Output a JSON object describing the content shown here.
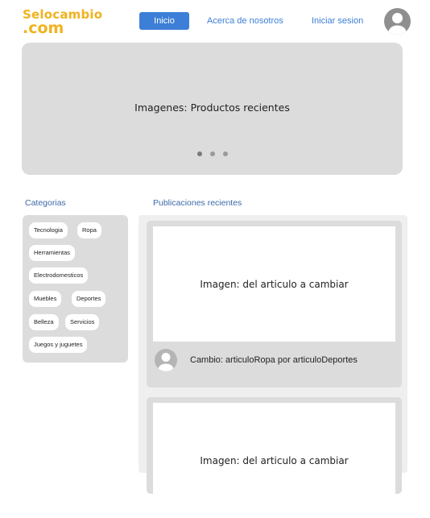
{
  "header": {
    "logo_line1": "Selocambio",
    "logo_line2": ".com",
    "nav": {
      "inicio": "Inicio",
      "acerca": "Acerca de nosotros",
      "login": "Iniciar sesion"
    },
    "avatar_icon": "user-avatar-icon"
  },
  "hero": {
    "text": "Imagenes: Productos recientes",
    "dots_count": 3,
    "active_dot": 1
  },
  "categories": {
    "title": "Categorias",
    "items": [
      "Tecnologia",
      "Ropa",
      "Herramientas",
      "Electrodomesticos",
      "Muebles",
      "Deportes",
      "Belleza",
      "Servicios",
      "Juegos y juguetes"
    ]
  },
  "publications": {
    "title": "Publicaciones recientes",
    "cards": [
      {
        "image_text": "Imagen: del articulo a cambiar",
        "caption": "Cambio:  articuloRopa por articuloDeportes"
      },
      {
        "image_text": "Imagen: del articulo a cambiar"
      }
    ]
  },
  "colors": {
    "brand_orange": "#f0b21e",
    "accent_blue": "#3d7fd6",
    "panel_gray": "#dcdcdc"
  }
}
